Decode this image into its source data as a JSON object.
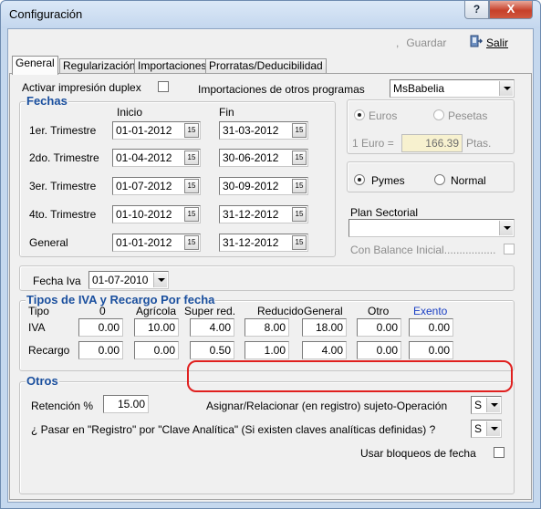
{
  "window": {
    "title": "Configuración",
    "help_label": "?",
    "close_label": "X"
  },
  "toolbar": {
    "save_label": "Guardar",
    "exit_label": "Salir"
  },
  "tabs": [
    "General",
    "Regularización",
    "Importaciones",
    "Prorratas/Deducibilidad"
  ],
  "top": {
    "duplex_label": "Activar impresión duplex",
    "import_label": "Importaciones  de otros programas",
    "import_value": "MsBabelia"
  },
  "fechas": {
    "legend": "Fechas",
    "col_start": "Inicio",
    "col_end": "Fin",
    "rows": [
      {
        "label": "1er. Trimestre",
        "start": "01-01-2012",
        "end": "31-03-2012"
      },
      {
        "label": "2do. Trimestre",
        "start": "01-04-2012",
        "end": "30-06-2012"
      },
      {
        "label": "3er. Trimestre",
        "start": "01-07-2012",
        "end": "30-09-2012"
      },
      {
        "label": "4to. Trimestre",
        "start": "01-10-2012",
        "end": "31-12-2012"
      },
      {
        "label": "General",
        "start": "01-01-2012",
        "end": "31-12-2012"
      }
    ],
    "cal_icon_text": "15"
  },
  "currency": {
    "euros_label": "Euros",
    "pesetas_label": "Pesetas",
    "rate_label": "1 Euro =",
    "rate_value": "166.39",
    "rate_unit": "Ptas."
  },
  "company": {
    "pymes_label": "Pymes",
    "normal_label": "Normal"
  },
  "plan": {
    "label": "Plan Sectorial",
    "value": "",
    "balance_label": "Con Balance Inicial................."
  },
  "fecha_iva": {
    "label": "Fecha Iva",
    "value": "01-07-2010"
  },
  "iva": {
    "legend": "Tipos de IVA y Recargo Por fecha",
    "headers": [
      "Tipo",
      "0",
      "Agrícola",
      "Super red.",
      "Reducido",
      "General",
      "Otro",
      "Exento"
    ],
    "rows": [
      {
        "label": "IVA",
        "values": [
          "0.00",
          "10.00",
          "4.00",
          "8.00",
          "18.00",
          "0.00",
          "0.00"
        ]
      },
      {
        "label": "Recargo",
        "values": [
          "0.00",
          "0.00",
          "0.50",
          "1.00",
          "4.00",
          "0.00",
          "0.00"
        ]
      }
    ]
  },
  "otros": {
    "legend": "Otros",
    "retencion_label": "Retención %",
    "retencion_value": "15.00",
    "asignar_label": "Asignar/Relacionar (en registro) sujeto-Operación",
    "asignar_value": "S",
    "pasar_label": "¿ Pasar en \"Registro\" por \"Clave Analítica\" (Si existen claves analíticas definidas) ?",
    "pasar_value": "S",
    "bloqueos_label": "Usar bloqueos de fecha"
  },
  "colors": {
    "highlight": "#e0201f",
    "legend": "#1a4f9e",
    "exento_header": "#1a3fc4"
  }
}
